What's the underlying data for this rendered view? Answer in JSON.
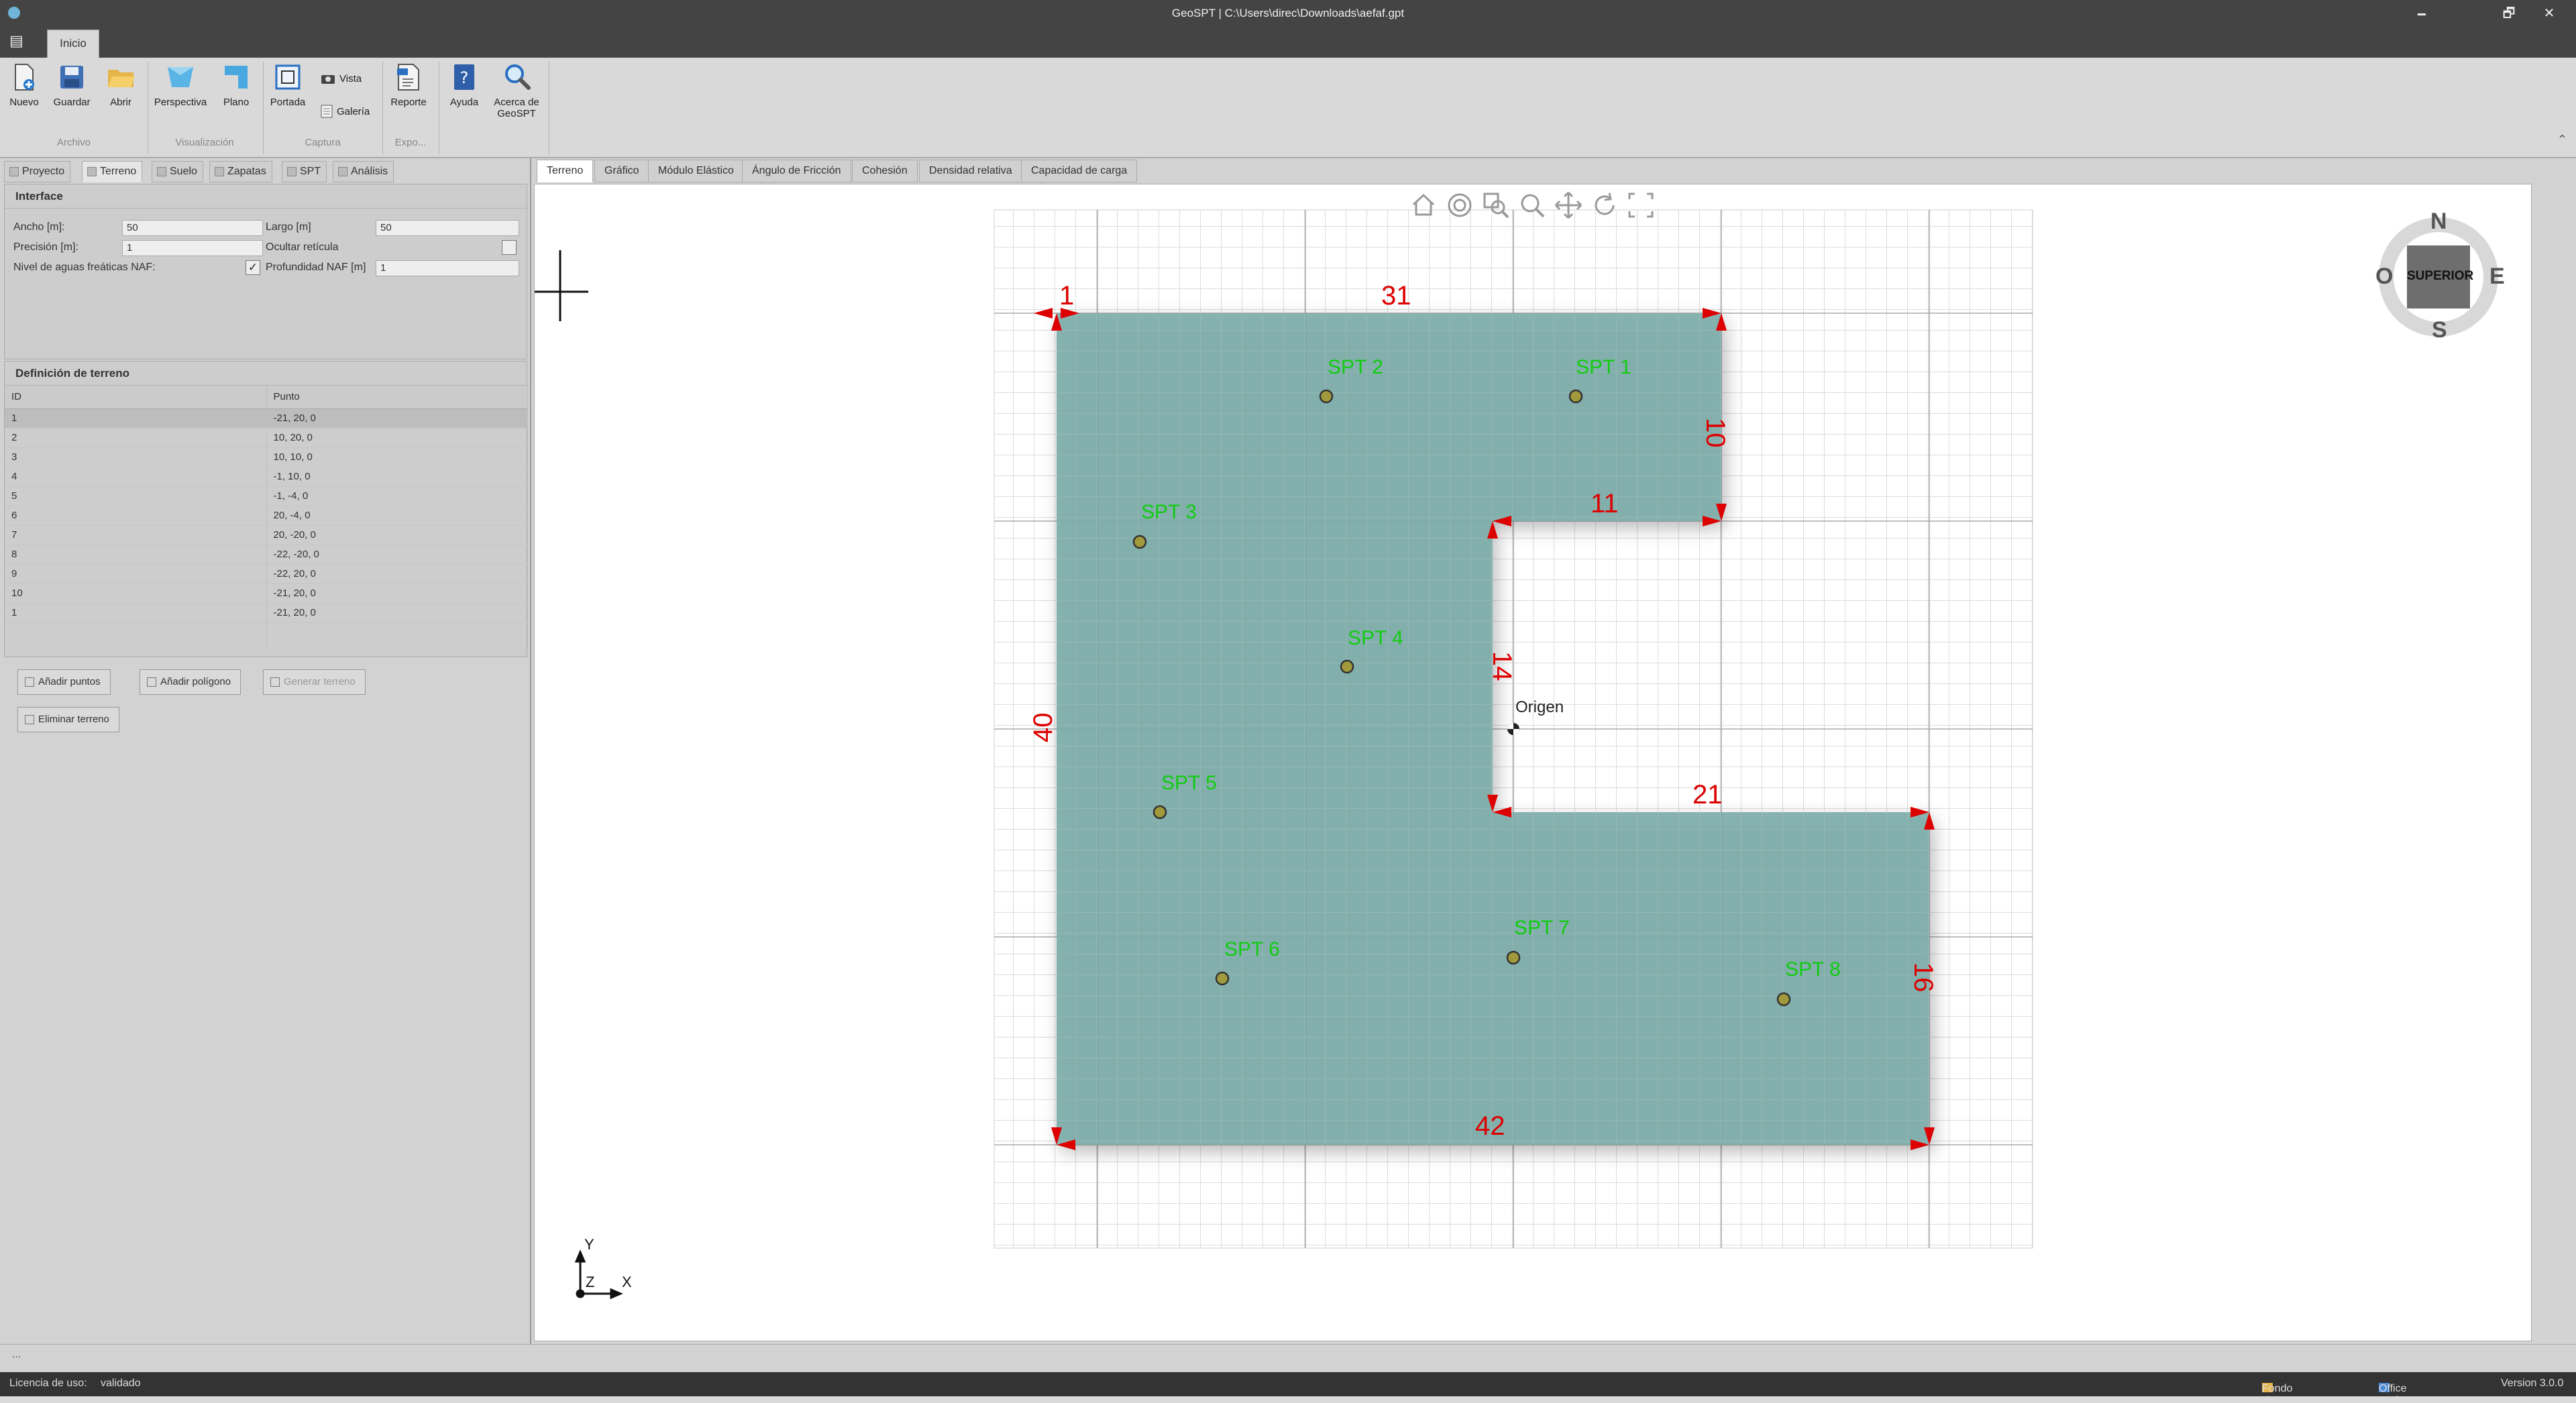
{
  "titlebar": {
    "title": "GeoSPT | C:\\Users\\direc\\Downloads\\aefaf.gpt",
    "minimize": "🗕",
    "restore": "🗗",
    "close": "✕",
    "menu": "▤"
  },
  "ribbon_tabs": {
    "home": "Inicio"
  },
  "ribbon": {
    "nuevo": "Nuevo",
    "guardar": "Guardar",
    "abrir": "Abrir",
    "group_archivo": "Archivo",
    "perspectiva": "Perspectiva",
    "plano": "Plano",
    "group_visualizacion": "Visualización",
    "portada": "Portada",
    "vista": "Vista",
    "galeria": "Galería",
    "group_captura": "Captura",
    "reporte": "Reporte",
    "group_expo": "Expo...",
    "ayuda": "Ayuda",
    "acerca_1": "Acerca de",
    "acerca_2": "GeoSPT",
    "collapse": "⌃"
  },
  "panel_tabs": [
    "Proyecto",
    "Terreno",
    "Suelo",
    "Zapatas",
    "SPT",
    "Análisis"
  ],
  "interface": {
    "title": "Interface",
    "ancho_label": "Ancho [m]:",
    "ancho_value": "50",
    "largo_label": "Largo [m]",
    "largo_value": "50",
    "precision_label": "Precisión [m]:",
    "precision_value": "1",
    "ocultar_label": "Ocultar retícula",
    "naf_label": "Nivel de aguas freáticas NAF:",
    "prof_label": "Profundidad NAF [m]",
    "prof_value": "1",
    "check_mark": "✓"
  },
  "terrain_def": {
    "title": "Definición de terreno",
    "col_id": "ID",
    "col_point": "Punto",
    "rows": [
      {
        "id": "1",
        "p": "-21, 20, 0"
      },
      {
        "id": "2",
        "p": "10, 20, 0"
      },
      {
        "id": "3",
        "p": "10, 10, 0"
      },
      {
        "id": "4",
        "p": "-1, 10, 0"
      },
      {
        "id": "5",
        "p": "-1, -4, 0"
      },
      {
        "id": "6",
        "p": "20, -4, 0"
      },
      {
        "id": "7",
        "p": "20, -20, 0"
      },
      {
        "id": "8",
        "p": "-22, -20, 0"
      },
      {
        "id": "9",
        "p": "-22, 20, 0"
      },
      {
        "id": "10",
        "p": "-21, 20, 0"
      },
      {
        "id": "1",
        "p": "-21, 20, 0"
      }
    ]
  },
  "buttons": {
    "add_points": "Añadir puntos",
    "add_polygon": "Añadir polígono",
    "generate": "Generar terreno",
    "delete": "Eliminar terreno"
  },
  "view_tabs": [
    "Terreno",
    "Gráfico",
    "Módulo Elástico",
    "Ángulo de Fricción",
    "Cohesión",
    "Densidad relativa",
    "Capacidad de carga"
  ],
  "viewport": {
    "dims": [
      "1",
      "31",
      "10",
      "11",
      "14",
      "40",
      "21",
      "16",
      "42"
    ],
    "spts": [
      "SPT 1",
      "SPT 2",
      "SPT 3",
      "SPT 4",
      "SPT 5",
      "SPT 6",
      "SPT 7",
      "SPT 8"
    ],
    "origin": "Origen",
    "viewcube": {
      "n": "N",
      "s": "S",
      "e": "E",
      "o": "O",
      "face": "SUPERIOR"
    },
    "axes": {
      "y": "Y",
      "x": "X",
      "z": "Z"
    }
  },
  "status": {
    "dots": "...",
    "license_label": "Licencia de uso:",
    "license_value": "validado",
    "fondo": "Fondo viewport ▾",
    "theme": "Office Dark Gray ▾",
    "version": "Version 3.0.0"
  },
  "colors": {
    "terrain": "#7eaeab",
    "dims": "#dd0000",
    "spt": "#11cc11"
  }
}
